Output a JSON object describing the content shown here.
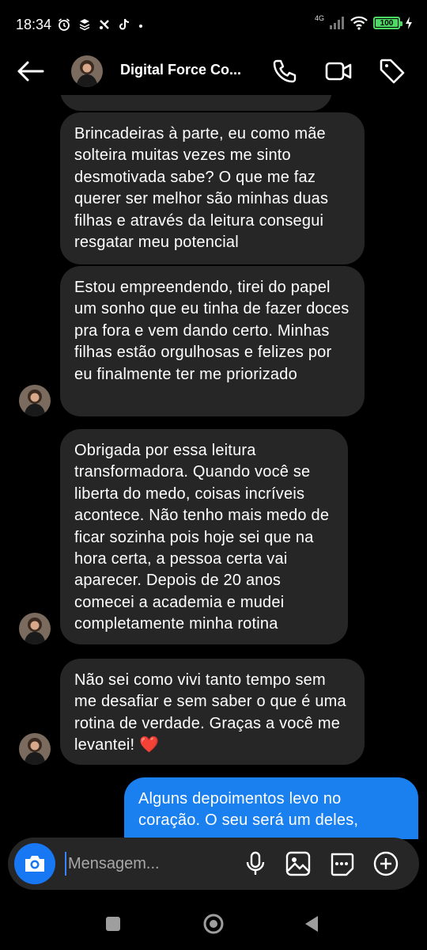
{
  "status_bar": {
    "time": "18:34",
    "left_icons": [
      "alarm-icon",
      "layers-icon",
      "shuffle-icon",
      "tiktok-icon",
      "dot-icon"
    ],
    "network": "4G",
    "battery": "100",
    "battery_level": 1.0,
    "battery_color": "#4cd964"
  },
  "header": {
    "title": "Digital Force Co...",
    "icons": [
      "back-arrow-icon",
      "phone-icon",
      "video-icon",
      "tag-icon"
    ]
  },
  "messages": [
    {
      "direction": "in",
      "text": "Brincadeiras à parte, eu como mãe solteira muitas vezes me sinto desmotivada sabe? O que me faz querer ser melhor são minhas duas filhas e através da leitura consegui resgatar meu potencial",
      "avatar": false
    },
    {
      "direction": "in",
      "text": "Estou empreendendo, tirei do papel um sonho que eu tinha de fazer doces pra fora e vem dando certo. Minhas filhas estão orgulhosas e felizes por eu finalmente ter me priorizado",
      "avatar": true
    },
    {
      "direction": "in",
      "text": "Obrigada por essa leitura transformadora. Quando você se liberta do medo, coisas incríveis acontece. Não tenho mais medo de ficar sozinha pois hoje sei que na hora certa, a pessoa certa vai aparecer. Depois de 20 anos comecei a academia e mudei completamente minha rotina",
      "avatar": true
    },
    {
      "direction": "in",
      "text": "Não sei como vivi tanto tempo sem me desafiar e sem saber o que é uma rotina de verdade. Graças a você me levantei! ❤️",
      "avatar": true
    },
    {
      "direction": "out",
      "text": "Alguns depoimentos levo no coração. O seu será um deles,",
      "avatar": false
    }
  ],
  "composer": {
    "placeholder": "Mensagem...",
    "icons": [
      "camera-icon",
      "microphone-icon",
      "gallery-icon",
      "sticker-icon",
      "plus-icon"
    ]
  },
  "colors": {
    "background": "#000000",
    "incoming_bubble": "#262626",
    "outgoing_bubble": "#1a80f0",
    "accent": "#1877f2"
  },
  "navbar": {
    "icons": [
      "recents-icon",
      "home-icon",
      "back-icon"
    ]
  }
}
